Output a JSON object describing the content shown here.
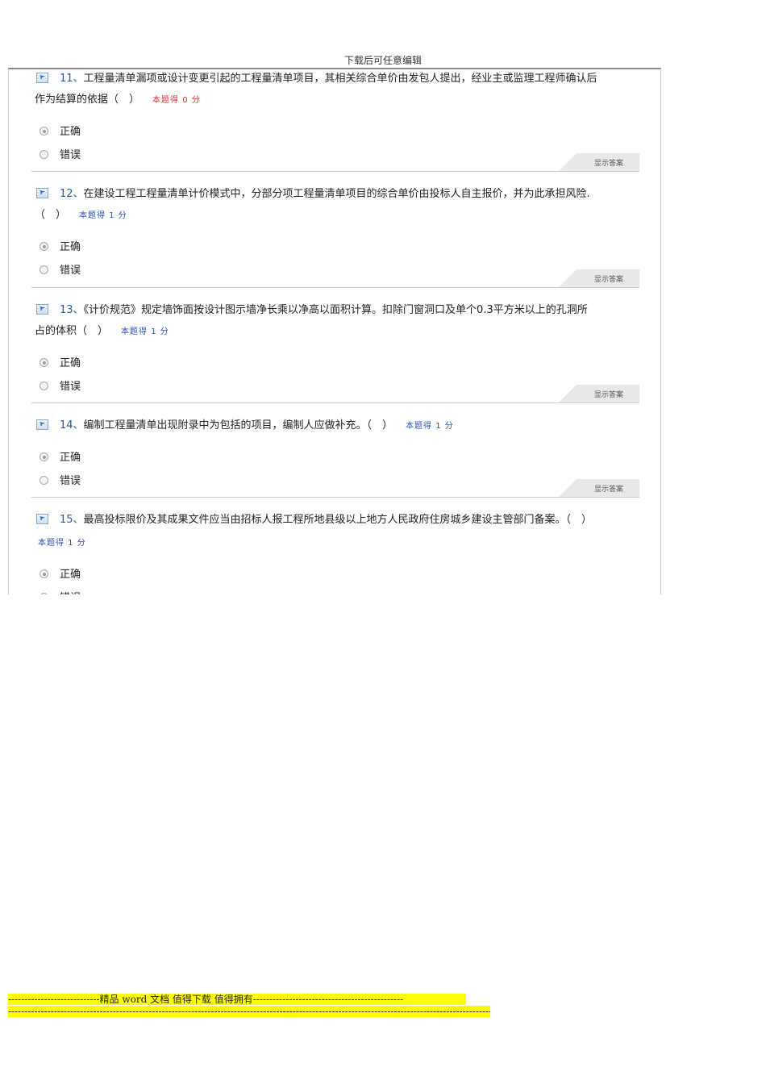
{
  "header": {
    "text": "下载后可任意编辑"
  },
  "questions": [
    {
      "number": "11、",
      "line1": "工程量清单漏项或设计变更引起的工程量清单项目，其相关综合单价由发包人提出，经业主或监理工程师确认后",
      "line2": "作为结算的依据（　）",
      "score": "本题得 0 分",
      "option_a": "正确",
      "option_b": "错误",
      "show_answer": "显示答案"
    },
    {
      "number": "12、",
      "line1": "在建设工程工程量清单计价模式中，分部分项工程量清单项目的综合单价由投标人自主报价，并为此承担风险.",
      "line2": "（　）",
      "score": "本题得 1 分",
      "option_a": "正确",
      "option_b": "错误",
      "show_answer": "显示答案"
    },
    {
      "number": "13、",
      "line1": "《计价规范》规定墙饰面按设计图示墙净长乘以净高以面积计算。扣除门窗洞口及单个0.3平方米以上的孔洞所",
      "line2": "占的体积（　）",
      "score": "本题得 1 分",
      "option_a": "正确",
      "option_b": "错误",
      "show_answer": "显示答案"
    },
    {
      "number": "14、",
      "line1": "编制工程量清单出现附录中为包括的项目，编制人应做补充。（　）",
      "line2": "",
      "score": "本题得 1 分",
      "option_a": "正确",
      "option_b": "错误",
      "show_answer": "显示答案"
    },
    {
      "number": "15、",
      "line1": "最高投标限价及其成果文件应当由招标人报工程所地县级以上地方人民政府住房城乡建设主管部门备案。（　）",
      "line2": "",
      "score": "本题得 1 分",
      "option_a": "正确",
      "option_b": "错误"
    }
  ],
  "footer": {
    "line1": "----------------------------精品 word 文档 值得下载 值得拥有----------------------------------------------",
    "line2": "--------------------------------------------------------------------------------------------------------------------------------------------------------------"
  }
}
